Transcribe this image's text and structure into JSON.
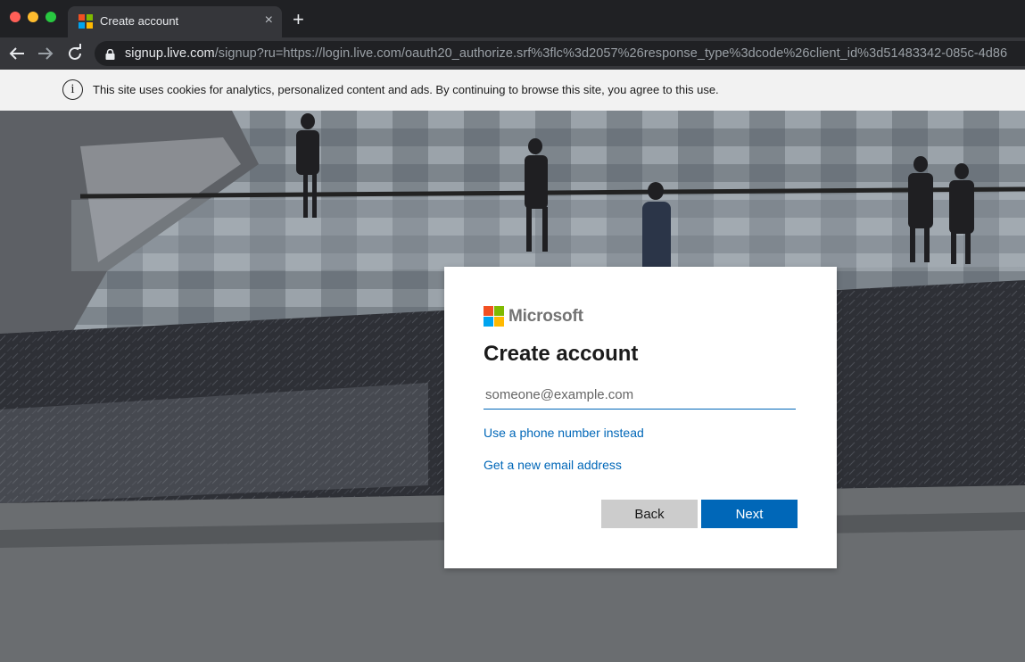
{
  "browser": {
    "tab_title": "Create account",
    "tab_close_glyph": "×",
    "new_tab_glyph": "+",
    "url_host": "signup.live.com",
    "url_path": "/signup?ru=https://login.live.com/oauth20_authorize.srf%3flc%3d2057%26response_type%3dcode%26client_id%3d51483342-085c-4d86"
  },
  "cookie_banner": {
    "icon": "info-icon",
    "text": "This site uses cookies for analytics, personalized content and ads. By continuing to browse this site, you agree to this use."
  },
  "card": {
    "brand": "Microsoft",
    "title": "Create account",
    "email_placeholder": "someone@example.com",
    "email_value": "",
    "phone_link": "Use a phone number instead",
    "new_email_link": "Get a new email address",
    "back_label": "Back",
    "next_label": "Next"
  },
  "colors": {
    "accent": "#0067b8",
    "logo_red": "#f25022",
    "logo_green": "#7fba00",
    "logo_blue": "#00a4ef",
    "logo_yellow": "#ffb900"
  }
}
